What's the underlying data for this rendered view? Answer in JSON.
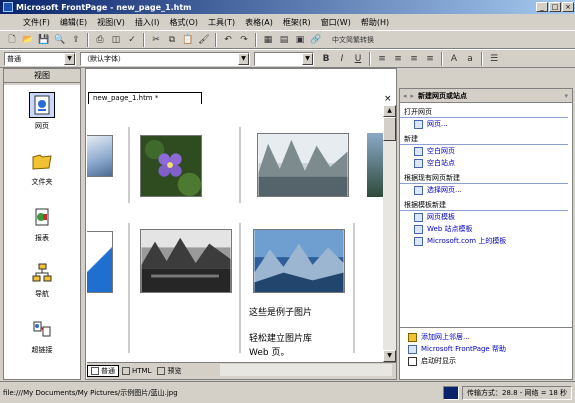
{
  "window": {
    "title": "Microsoft FrontPage - new_page_1.htm",
    "controls": [
      "_",
      "□",
      "×"
    ]
  },
  "menus": [
    "文件(F)",
    "编辑(E)",
    "视图(V)",
    "插入(I)",
    "格式(O)",
    "工具(T)",
    "表格(A)",
    "框架(R)",
    "窗口(W)",
    "帮助(H)"
  ],
  "formatting": {
    "style": "普通",
    "font": "（默认字体）",
    "size": "",
    "bold": "B",
    "italic": "I",
    "underline": "U",
    "lang_convert": "中文简繁转换"
  },
  "views_bar": {
    "header": "视图",
    "items": [
      {
        "label": "网页",
        "icon": "page-view-icon"
      },
      {
        "label": "文件夹",
        "icon": "folder-view-icon"
      },
      {
        "label": "报表",
        "icon": "reports-view-icon"
      },
      {
        "label": "导航",
        "icon": "navigation-view-icon"
      },
      {
        "label": "超链接",
        "icon": "hyperlinks-view-icon"
      }
    ]
  },
  "document": {
    "tab": "new_page_1.htm *",
    "close": "×",
    "captions": {
      "line1": "这些是例子图片",
      "line2": "轻松建立图片库",
      "line3": "Web 页。"
    }
  },
  "bottom_tabs": [
    "普通",
    "HTML",
    "预览"
  ],
  "task_pane": {
    "title": "新建网页或站点",
    "sections": [
      {
        "heading": "打开网页",
        "links": [
          "网页..."
        ]
      },
      {
        "heading": "新建",
        "links": [
          "空白网页",
          "空白站点"
        ]
      },
      {
        "heading": "根据现有网页新建",
        "links": [
          "选择网页..."
        ]
      },
      {
        "heading": "根据模板新建",
        "links": [
          "网页模板",
          "Web 站点模板",
          "Microsoft.com 上的模板"
        ]
      }
    ],
    "footer_links": [
      "添加网上邻居...",
      "Microsoft FrontPage 帮助",
      "启动时显示"
    ]
  },
  "status": {
    "path": "file:///My Documents/My Pictures/示例图片/蓝山.jpg",
    "mode": "传输方式：28.8 - 网络 = 18 秒"
  },
  "colors": {
    "title_start": "#0a246a",
    "title_end": "#a6caf0",
    "link": "#0000c0"
  }
}
